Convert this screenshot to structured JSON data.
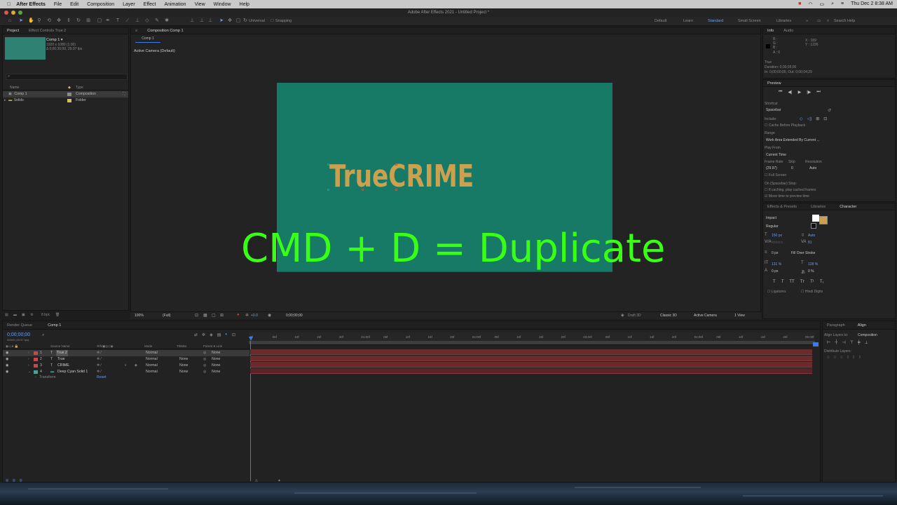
{
  "menubar": {
    "apple_icon": "apple-icon",
    "app_name": "After Effects",
    "items": [
      "File",
      "Edit",
      "Composition",
      "Layer",
      "Effect",
      "Animation",
      "View",
      "Window",
      "Help"
    ],
    "clock": "Thu Dec 2  8:38 AM"
  },
  "window": {
    "title": "Adobe After Effects 2021 - Untitled Project *"
  },
  "toolbar": {
    "axis_mode": "Universal",
    "snapping": "Snapping",
    "workspaces": [
      "Default",
      "Learn",
      "Standard",
      "Small Screen",
      "Libraries"
    ],
    "active_workspace": "Standard",
    "search_placeholder": "Search Help"
  },
  "project": {
    "tabs": [
      "Project",
      "Effect Controls True 2"
    ],
    "comp_name": "Comp 1 ▾",
    "comp_info_1": "1920 x 1080 (1.00)",
    "comp_info_2": "Δ 0;00;30;00, 29.97 fps",
    "col_name": "Name",
    "col_type": "Type",
    "items": [
      {
        "name": "Comp 1",
        "type": "Composition",
        "color": "#8a8a8a"
      },
      {
        "name": "Solids",
        "type": "Folder",
        "color": "#d4c15a"
      }
    ],
    "bpc": "8 bpc"
  },
  "composition": {
    "tab": "Composition Comp 1",
    "breadcrumb": "Comp 1",
    "camera_label": "Active Camera (Default)",
    "zoom": "100%",
    "resolution": "(Full)",
    "exposure": "+0.0",
    "timecode": "0;00;00;00",
    "renderer": "Draft 3D",
    "renderer_mode": "Classic 3D",
    "view_camera": "Active Camera",
    "view_count": "1 View",
    "bg_color": "#177a66"
  },
  "canvas_text": {
    "title": "TrueCRIME",
    "title_color": "#cba04f"
  },
  "overlay_text": {
    "caption": "CMD + D = Duplicate",
    "color": "#39ff14"
  },
  "info": {
    "tabs": [
      "Info",
      "Audio"
    ],
    "r": "R :",
    "g": "G :",
    "b": "B :",
    "a": "A : 0",
    "x": "X : 189",
    "y": "Y : 1226",
    "layer": "True",
    "duration": "Duration: 0;00;05;00",
    "inout": "In: 0;00;00;00, Out: 0;00;04;29"
  },
  "preview": {
    "title": "Preview",
    "shortcut_label": "Shortcut",
    "shortcut": "Spacebar",
    "include_label": "Include:",
    "cache": "Cache Before Playback",
    "range_label": "Range",
    "range": "Work Area Extended By Current ...",
    "play_from_label": "Play From",
    "play_from": "Current Time",
    "frame_rate_label": "Frame Rate",
    "skip_label": "Skip",
    "resolution_label": "Resolution",
    "frame_rate": "(29.97)",
    "skip": "0",
    "resolution": "Auto",
    "full_screen": "Full Screen",
    "on_stop": "On (Spacebar) Stop:",
    "if_caching": "If caching, play cached frames",
    "move_time": "Move time to preview time"
  },
  "character": {
    "tabs": [
      "Effects & Presets",
      "Libraries",
      "Character"
    ],
    "font": "Impact",
    "style": "Regular",
    "size": "150 px",
    "leading": "Auto",
    "kerning": "Metrics",
    "tracking": "81",
    "stroke_width": "0 px",
    "stroke_mode": "Fill Over Stroke",
    "vscale": "131 %",
    "hscale": "128 %",
    "baseline": "0 px",
    "tsume": "0 %",
    "ligatures": "Ligatures",
    "hindi": "Hindi Digits",
    "fill_color": "#cba04f"
  },
  "timeline": {
    "tabs": [
      "Render Queue",
      "Comp 1"
    ],
    "timecode": "0;00;00;00",
    "timecode_sub": "00000 (29.97 fps)",
    "headers": {
      "source": "Source Name",
      "mode": "Mode",
      "trkmat": "TrkMat",
      "parent": "Parent & Link"
    },
    "layers": [
      {
        "num": "1",
        "type": "T",
        "name": "True 2",
        "mode": "Normal",
        "trkmat": "",
        "parent": "None",
        "color": "#c44a4a"
      },
      {
        "num": "2",
        "type": "T",
        "name": "True",
        "mode": "Normal",
        "trkmat": "None",
        "parent": "None",
        "color": "#c44a4a"
      },
      {
        "num": "3",
        "type": "T",
        "name": "CRIME",
        "mode": "Normal",
        "trkmat": "None",
        "parent": "None",
        "color": "#c44a4a"
      },
      {
        "num": "4",
        "type": "▬",
        "name": "Deep Cyan Solid 1",
        "mode": "Normal",
        "trkmat": "None",
        "parent": "None",
        "color": "#4aa19a"
      }
    ],
    "transform": "Transform",
    "reset": "Reset",
    "ruler": [
      "0f",
      "05f",
      "10f",
      "15f",
      "20f",
      "01:00f",
      "05f",
      "10f",
      "15f",
      "20f",
      "02:00f",
      "05f",
      "10f",
      "15f",
      "20f",
      "03:00f",
      "05f",
      "10f",
      "15f",
      "20f",
      "04:00f",
      "05f",
      "10f",
      "15f",
      "20f",
      "05:00f"
    ]
  },
  "align": {
    "tabs": [
      "Paragraph",
      "Align"
    ],
    "align_to_label": "Align Layers to:",
    "align_to": "Composition",
    "distribute": "Distribute Layers:"
  }
}
